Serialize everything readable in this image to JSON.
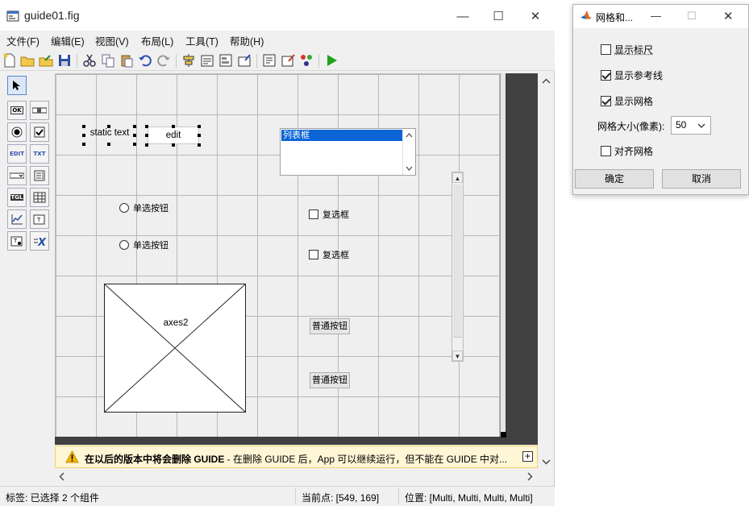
{
  "main_window": {
    "title": "guide01.fig",
    "controls": {
      "minimize": "—",
      "maximize": "☐",
      "close": "✕"
    }
  },
  "menu": [
    "文件(F)",
    "编辑(E)",
    "视图(V)",
    "布局(L)",
    "工具(T)",
    "帮助(H)"
  ],
  "canvas": {
    "static_text": "static text",
    "edit_text": "edit",
    "listbox_item": "列表框",
    "radio_1": "单选按钮",
    "radio_2": "单选按钮",
    "check_1": "复选框",
    "check_2": "复选框",
    "axes_label": "axes2",
    "push_1": "普通按钮",
    "push_2": "普通按钮"
  },
  "warning": {
    "bold": "在以后的版本中将会删除 GUIDE",
    "rest": " - 在删除 GUIDE 后，App 可以继续运行，但不能在 GUIDE 中对...",
    "expand": "+"
  },
  "status": {
    "tag": "标签: 已选择 2 个组件",
    "current_point": "当前点:   [549, 169]",
    "position": "位置: [Multi, Multi, Multi, Multi]"
  },
  "grid_dialog": {
    "title": "网格和...",
    "show_rulers": "显示标尺",
    "show_guides": "显示参考线",
    "show_grid": "显示网格",
    "grid_size_label": "网格大小(像素):",
    "grid_size_value": "50",
    "snap_to_grid": "对齐网格",
    "ok": "确定",
    "cancel": "取消",
    "checked": {
      "show_rulers": false,
      "show_guides": true,
      "show_grid": true,
      "snap_to_grid": false
    }
  },
  "colors": {
    "selection": "#0a64d6",
    "warning_bg": "#fff6d6",
    "run_green": "#1fa31f"
  }
}
